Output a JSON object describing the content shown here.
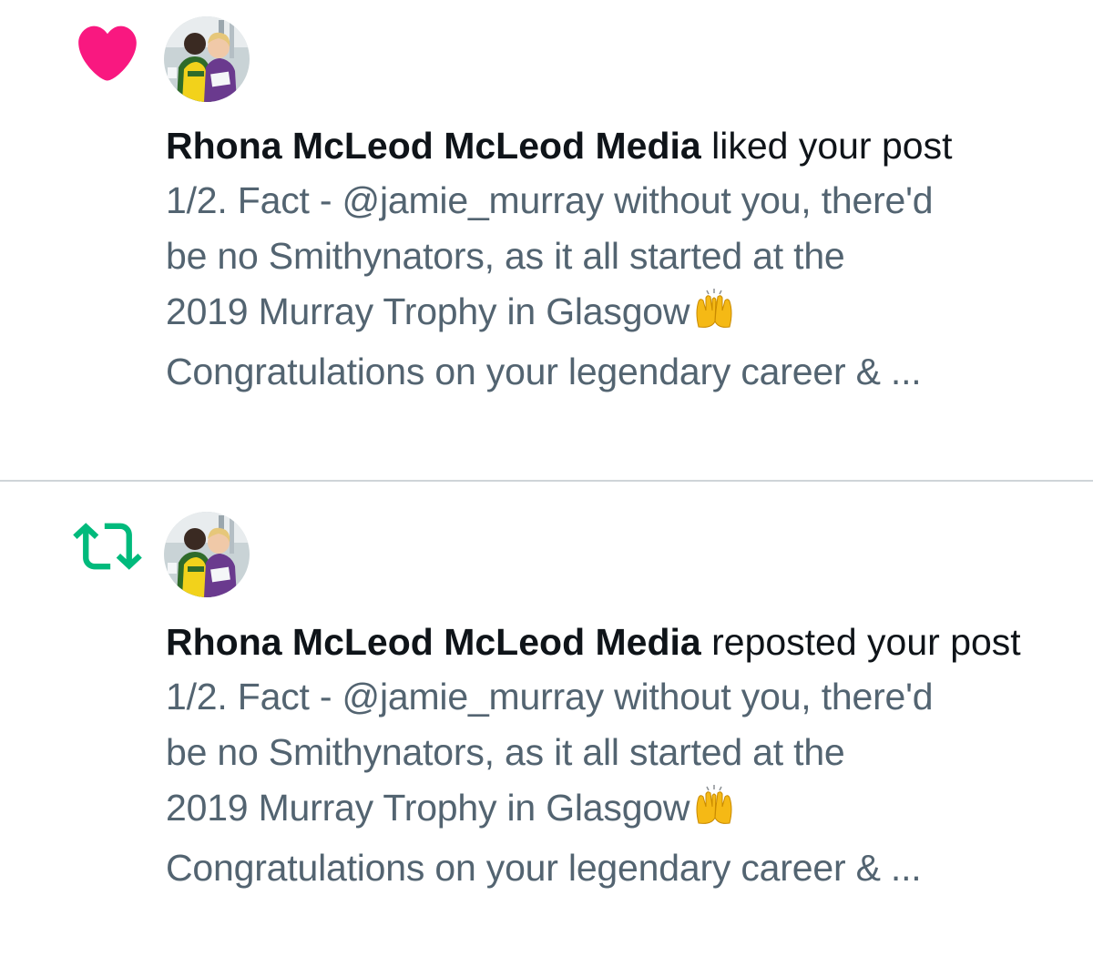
{
  "notifications": [
    {
      "type": "like",
      "icon": "heart-icon",
      "icon_color": "#f91880",
      "actor": "Rhona McLeod McLeod Media",
      "action_text": "liked your post",
      "preview": {
        "line1": "1/2. Fact - @jamie_murray without you, there'd",
        "line2": "be no Smithynators, as it all started at the",
        "line3": "2019 Murray Trophy in Glasgow",
        "line4": "Congratulations on your legendary career & ..."
      }
    },
    {
      "type": "repost",
      "icon": "repost-icon",
      "icon_color": "#00ba7c",
      "actor": "Rhona McLeod McLeod Media",
      "action_text": "reposted your post",
      "preview": {
        "line1": "1/2. Fact - @jamie_murray without you, there'd",
        "line2": "be no Smithynators, as it all started at the",
        "line3": "2019 Murray Trophy in Glasgow",
        "line4": "Congratulations on your legendary career & ..."
      }
    }
  ],
  "colors": {
    "text_primary": "#0f1419",
    "text_secondary": "#536471",
    "divider": "#cfd4d8"
  }
}
